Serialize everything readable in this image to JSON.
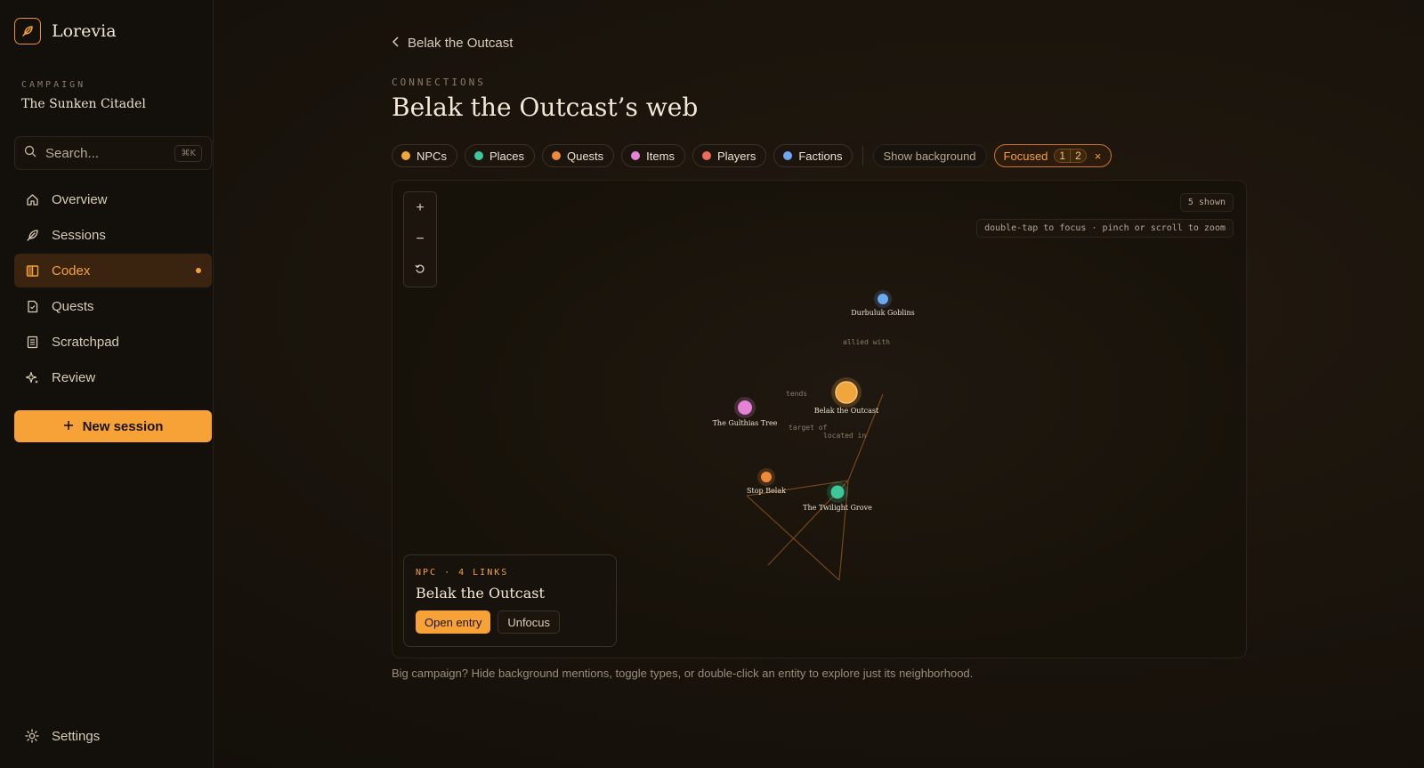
{
  "app": {
    "name": "Lorevia"
  },
  "campaign": {
    "label": "CAMPAIGN",
    "name": "The Sunken Citadel"
  },
  "search": {
    "placeholder": "Search...",
    "shortcut": "⌘K"
  },
  "nav": {
    "items": [
      {
        "label": "Overview",
        "icon": "home-icon"
      },
      {
        "label": "Sessions",
        "icon": "feather-icon"
      },
      {
        "label": "Codex",
        "icon": "book-icon",
        "active": true
      },
      {
        "label": "Quests",
        "icon": "scroll-icon"
      },
      {
        "label": "Scratchpad",
        "icon": "notebook-icon"
      },
      {
        "label": "Review",
        "icon": "sparkle-icon"
      }
    ],
    "new_session": "New session",
    "settings": "Settings"
  },
  "header": {
    "back_label": "Belak the Outcast",
    "section": "CONNECTIONS",
    "title": "Belak the Outcast’s web"
  },
  "filters": {
    "types": [
      {
        "label": "NPCs",
        "color": "#f0a63a"
      },
      {
        "label": "Places",
        "color": "#3ec79a"
      },
      {
        "label": "Quests",
        "color": "#ee8a3a"
      },
      {
        "label": "Items",
        "color": "#e483d6"
      },
      {
        "label": "Players",
        "color": "#ee6a5a"
      },
      {
        "label": "Factions",
        "color": "#6ea8ee"
      }
    ],
    "show_background": "Show background",
    "focused": {
      "label": "Focused",
      "depth_1": "1",
      "depth_2": "2",
      "clear": "×"
    }
  },
  "graph": {
    "shown": "5 shown",
    "hint": "double-tap to focus · pinch or scroll to zoom",
    "zoom_in": "+",
    "zoom_out": "−",
    "reset": "⟲",
    "nodes": [
      {
        "label": "Durbuluk Goblins",
        "color": "#6ea8ee"
      },
      {
        "label": "Belak the Outcast",
        "color": "#f0a63a",
        "focused": true
      },
      {
        "label": "The Gulthias Tree",
        "color": "#e483d6"
      },
      {
        "label": "Stop Belak",
        "color": "#ee8a3a"
      },
      {
        "label": "The Twilight Grove",
        "color": "#3ec79a"
      }
    ],
    "edges": [
      {
        "label": "allied with"
      },
      {
        "label": "tends"
      },
      {
        "label": "target of"
      },
      {
        "label": "located in"
      }
    ]
  },
  "selection": {
    "meta": "NPC · 4 LINKS",
    "title": "Belak the Outcast",
    "open": "Open entry",
    "unfocus": "Unfocus"
  },
  "footnote": "Big campaign? Hide background mentions, toggle types, or double-click an entity to explore just its neighborhood."
}
